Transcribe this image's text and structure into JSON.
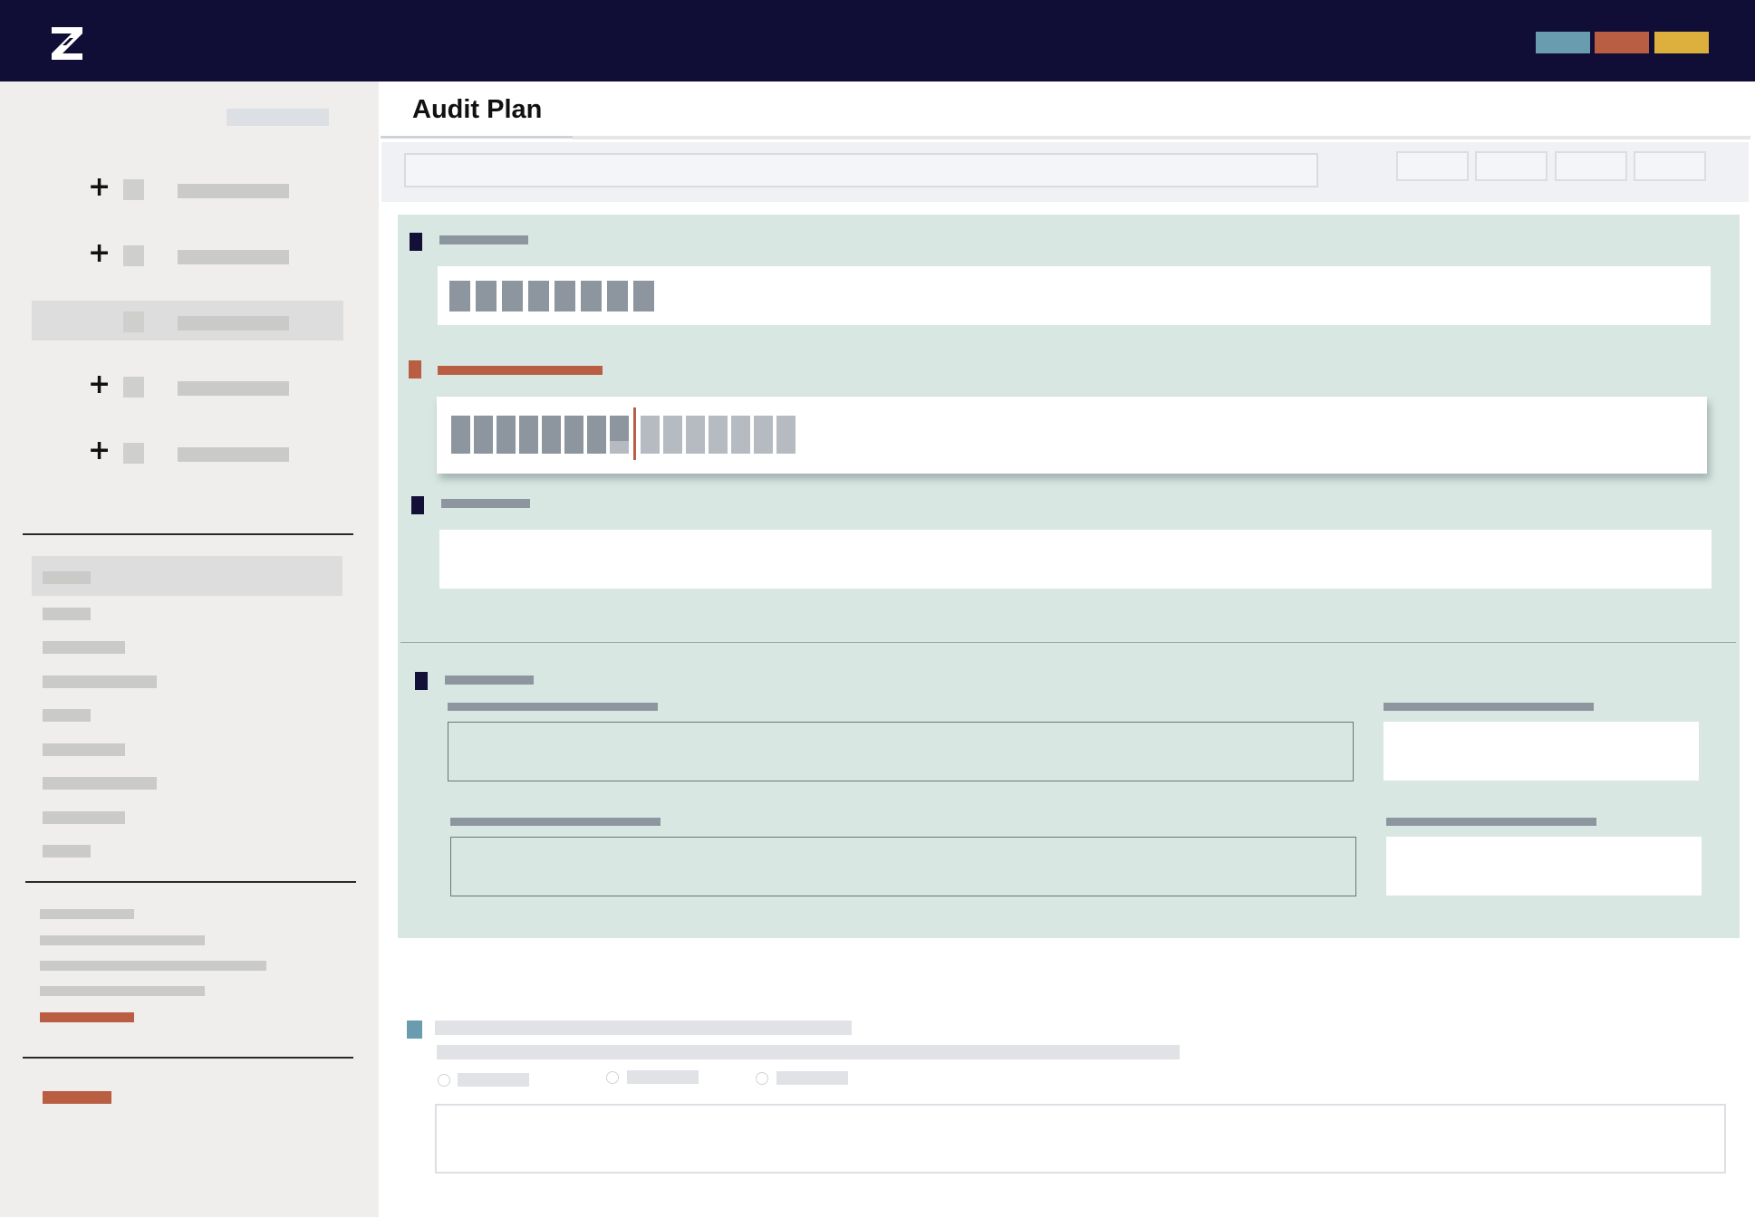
{
  "app": {
    "title": "Audit Plan",
    "logo_icon": "z-logo-icon"
  },
  "header": {
    "swatches": [
      "#6a9cb0",
      "#b95e43",
      "#ddb03e"
    ]
  },
  "colors": {
    "topbar": "#100e36",
    "sidebar": "#efeeec",
    "panel": "#d9e7e3",
    "accent": "#b95e43",
    "marker": "#121036",
    "info_marker": "#6a9cb0"
  },
  "sidebar": {
    "tree_items": [
      {
        "expand_icon": "plus-icon",
        "selected": false
      },
      {
        "expand_icon": "plus-icon",
        "selected": false
      },
      {
        "expand_icon": null,
        "selected": true
      },
      {
        "expand_icon": "plus-icon",
        "selected": false
      },
      {
        "expand_icon": "plus-icon",
        "selected": false
      }
    ],
    "sub_items_count_note": "",
    "active_link_color": "#b95e43"
  },
  "form": {
    "focused_field_caret_icon": "text-caret-icon",
    "required_marker_color": "#b95e43"
  }
}
